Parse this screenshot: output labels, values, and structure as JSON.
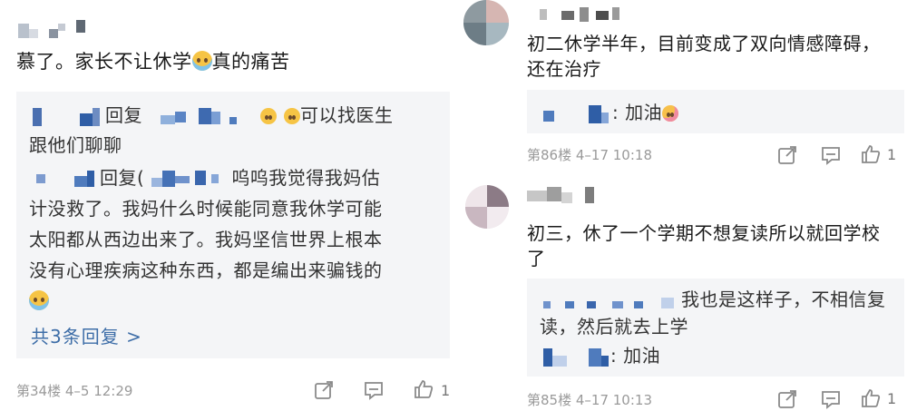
{
  "left": {
    "comment_text": "慕了。家长不让休学",
    "comment_text_tail": "真的痛苦",
    "reply1_tag": "回复",
    "reply1_text_a": "可以找医生",
    "reply1_text_b": "跟他们聊聊",
    "reply2_tag": "回复(",
    "reply2_lines": [
      "呜呜我觉得我妈估",
      "计没救了。我妈什么时候能同意我休学可能",
      "太阳都从西边出来了。我妈坚信世界上根本",
      "没有心理疾病这种东西，都是编出来骗钱的"
    ],
    "more_replies": "共3条回复 >",
    "meta": "第34楼  4–5  12:29",
    "like_count": "1"
  },
  "right": {
    "c1": {
      "text_lines": [
        "初二休学半年，目前变成了双向情感障碍，",
        "还在治疗"
      ],
      "reply_text": ": 加油",
      "meta": "第86楼  4–17  10:18",
      "like_count": "1"
    },
    "c2": {
      "text_lines": [
        "初三，休了一个学期不想复读所以就回学校",
        "了"
      ],
      "reply_a_text": "我也是这样子，不相信复",
      "reply_a_text2": "读，然后就去上学",
      "reply_b_text": ": 加油",
      "meta": "第85楼  4–17  10:13",
      "like_count": "1"
    }
  },
  "icons": [
    "share-icon",
    "comment-icon",
    "like-icon"
  ],
  "colors": {
    "link": "#3e6ea8",
    "reply_bg": "#f4f5f7",
    "meta": "#9a9a9a"
  }
}
